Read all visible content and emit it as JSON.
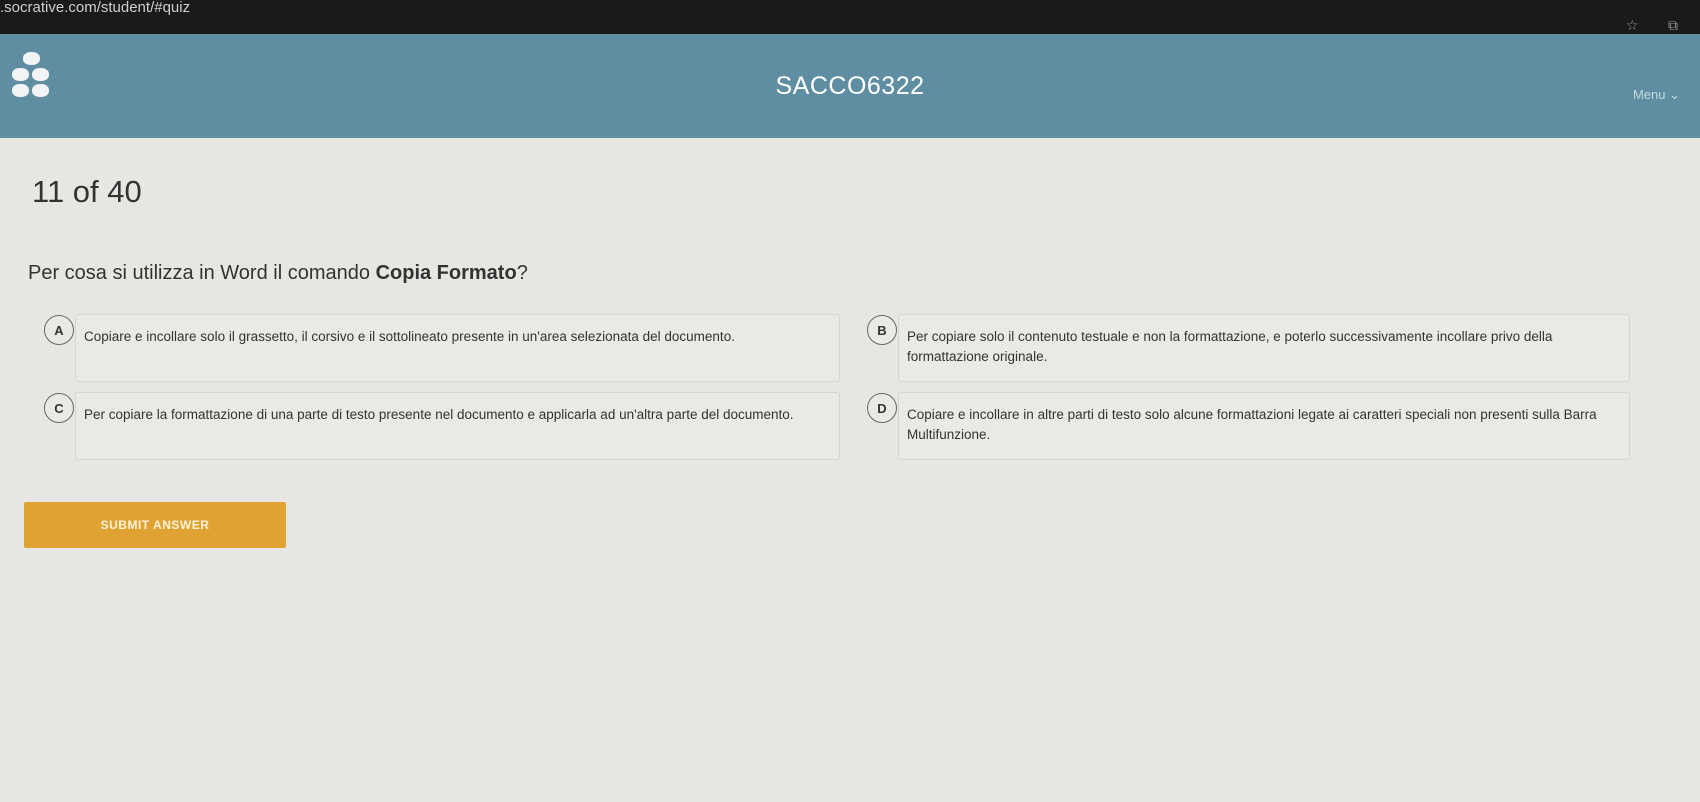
{
  "browser": {
    "url": ".socrative.com/student/#quiz",
    "star_icon": "star-icon",
    "extension_icon": "extension-icon"
  },
  "header": {
    "logo": "socrative-logo",
    "room_name": "SACCO6322",
    "menu_label": "Menu ⌄"
  },
  "quiz": {
    "progress": "11 of 40",
    "question_prefix": "Per cosa si utilizza in Word il comando ",
    "question_bold": "Copia Formato",
    "question_suffix": "?",
    "answers": [
      {
        "letter": "A",
        "text": "Copiare e incollare solo il grassetto, il  corsivo e il sottolineato presente in un'area selezionata del documento."
      },
      {
        "letter": "B",
        "text": "Per copiare solo il contenuto testuale e non la formattazione, e poterlo successivamente incollare privo della formattazione originale."
      },
      {
        "letter": "C",
        "text": "Per copiare la formattazione di una parte di testo presente nel documento e applicarla ad un'altra parte del documento."
      },
      {
        "letter": "D",
        "text": "Copiare e incollare in altre parti di testo solo alcune formattazioni legate ai caratteri speciali non presenti sulla Barra Multifunzione."
      }
    ],
    "submit_label": "SUBMIT ANSWER"
  },
  "colors": {
    "header_bg": "#5f8ea3",
    "content_bg": "#e8e6e2",
    "submit_bg": "#e0a233"
  }
}
